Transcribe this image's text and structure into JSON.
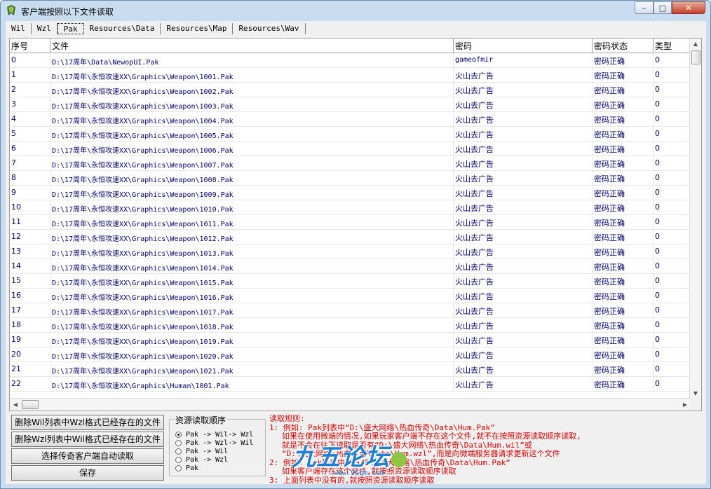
{
  "window": {
    "title": "客户端按照以下文件读取"
  },
  "tabs": [
    {
      "label": "Wil"
    },
    {
      "label": "Wzl"
    },
    {
      "label": "Pak"
    },
    {
      "label": "Resources\\Data"
    },
    {
      "label": "Resources\\Map"
    },
    {
      "label": "Resources\\Wav"
    }
  ],
  "table": {
    "columns": [
      "序号",
      "文件",
      "密码",
      "密码状态",
      "类型"
    ],
    "rows": [
      [
        "0",
        "D:\\17周年\\Data\\NewopUI.Pak",
        "gameofmir",
        "密码正确",
        "0"
      ],
      [
        "1",
        "D:\\17周年\\永恒攻速XX\\Graphics\\Weapon\\1001.Pak",
        "火山去广告",
        "密码正确",
        "0"
      ],
      [
        "2",
        "D:\\17周年\\永恒攻速XX\\Graphics\\Weapon\\1002.Pak",
        "火山去广告",
        "密码正确",
        "0"
      ],
      [
        "3",
        "D:\\17周年\\永恒攻速XX\\Graphics\\Weapon\\1003.Pak",
        "火山去广告",
        "密码正确",
        "0"
      ],
      [
        "4",
        "D:\\17周年\\永恒攻速XX\\Graphics\\Weapon\\1004.Pak",
        "火山去广告",
        "密码正确",
        "0"
      ],
      [
        "5",
        "D:\\17周年\\永恒攻速XX\\Graphics\\Weapon\\1005.Pak",
        "火山去广告",
        "密码正确",
        "0"
      ],
      [
        "6",
        "D:\\17周年\\永恒攻速XX\\Graphics\\Weapon\\1006.Pak",
        "火山去广告",
        "密码正确",
        "0"
      ],
      [
        "7",
        "D:\\17周年\\永恒攻速XX\\Graphics\\Weapon\\1007.Pak",
        "火山去广告",
        "密码正确",
        "0"
      ],
      [
        "8",
        "D:\\17周年\\永恒攻速XX\\Graphics\\Weapon\\1008.Pak",
        "火山去广告",
        "密码正确",
        "0"
      ],
      [
        "9",
        "D:\\17周年\\永恒攻速XX\\Graphics\\Weapon\\1009.Pak",
        "火山去广告",
        "密码正确",
        "0"
      ],
      [
        "10",
        "D:\\17周年\\永恒攻速XX\\Graphics\\Weapon\\1010.Pak",
        "火山去广告",
        "密码正确",
        "0"
      ],
      [
        "11",
        "D:\\17周年\\永恒攻速XX\\Graphics\\Weapon\\1011.Pak",
        "火山去广告",
        "密码正确",
        "0"
      ],
      [
        "12",
        "D:\\17周年\\永恒攻速XX\\Graphics\\Weapon\\1012.Pak",
        "火山去广告",
        "密码正确",
        "0"
      ],
      [
        "13",
        "D:\\17周年\\永恒攻速XX\\Graphics\\Weapon\\1013.Pak",
        "火山去广告",
        "密码正确",
        "0"
      ],
      [
        "14",
        "D:\\17周年\\永恒攻速XX\\Graphics\\Weapon\\1014.Pak",
        "火山去广告",
        "密码正确",
        "0"
      ],
      [
        "15",
        "D:\\17周年\\永恒攻速XX\\Graphics\\Weapon\\1015.Pak",
        "火山去广告",
        "密码正确",
        "0"
      ],
      [
        "16",
        "D:\\17周年\\永恒攻速XX\\Graphics\\Weapon\\1016.Pak",
        "火山去广告",
        "密码正确",
        "0"
      ],
      [
        "17",
        "D:\\17周年\\永恒攻速XX\\Graphics\\Weapon\\1017.Pak",
        "火山去广告",
        "密码正确",
        "0"
      ],
      [
        "18",
        "D:\\17周年\\永恒攻速XX\\Graphics\\Weapon\\1018.Pak",
        "火山去广告",
        "密码正确",
        "0"
      ],
      [
        "19",
        "D:\\17周年\\永恒攻速XX\\Graphics\\Weapon\\1019.Pak",
        "火山去广告",
        "密码正确",
        "0"
      ],
      [
        "20",
        "D:\\17周年\\永恒攻速XX\\Graphics\\Weapon\\1020.Pak",
        "火山去广告",
        "密码正确",
        "0"
      ],
      [
        "21",
        "D:\\17周年\\永恒攻速XX\\Graphics\\Weapon\\1021.Pak",
        "火山去广告",
        "密码正确",
        "0"
      ],
      [
        "22",
        "D:\\17周年\\永恒攻速XX\\Graphics\\Human\\1001.Pak",
        "火山去广告",
        "密码正确",
        "0"
      ]
    ]
  },
  "actions": {
    "buttons": [
      "删除Wil列表中Wzl格式已经存在的文件",
      "删除Wzl列表中Wil格式已经存在的文件",
      "选择传奇客户端自动读取",
      "保存"
    ]
  },
  "load_order": {
    "title": "资源读取顺序",
    "options": [
      "Pak -> Wil-> Wzl",
      "Pak -> Wzl-> Wil",
      "Pak -> Wil",
      "Pak -> Wzl",
      "Pak"
    ],
    "selected_index": 0
  },
  "rules": {
    "lines": [
      "读取规则:",
      "1: 例如: Pak列表中“D:\\盛大网络\\热血传奇\\Data\\Hum.Pak”",
      "如果在使用微端的情况,如果玩家客户端不存在这个文件,就不在按照资源读取顺序读取,",
      "就是不会在往下读取是否有“D:\\盛大网络\\热血传奇\\Data\\Hum.wil”或",
      "“D:\\盛大网络\\热血传奇\\Data\\Hum.wzl”,而是向微端服务器请求更新这个文件",
      "2: 例如: Pak列表中没有“D:\\盛大网络\\热血传奇\\Data\\Hum.Pak”",
      "如果客户端存在这个文件,就按照资源读取顺序读取",
      "3: 上面列表中没有的,就按照资源读取顺序读取"
    ]
  },
  "watermark": {
    "text": "九五论坛",
    "url": "www.95gm.com"
  },
  "colors": {
    "titlebar": "#c9dcf0",
    "rules_text": "#d00000",
    "cell_text": "#00006a"
  }
}
